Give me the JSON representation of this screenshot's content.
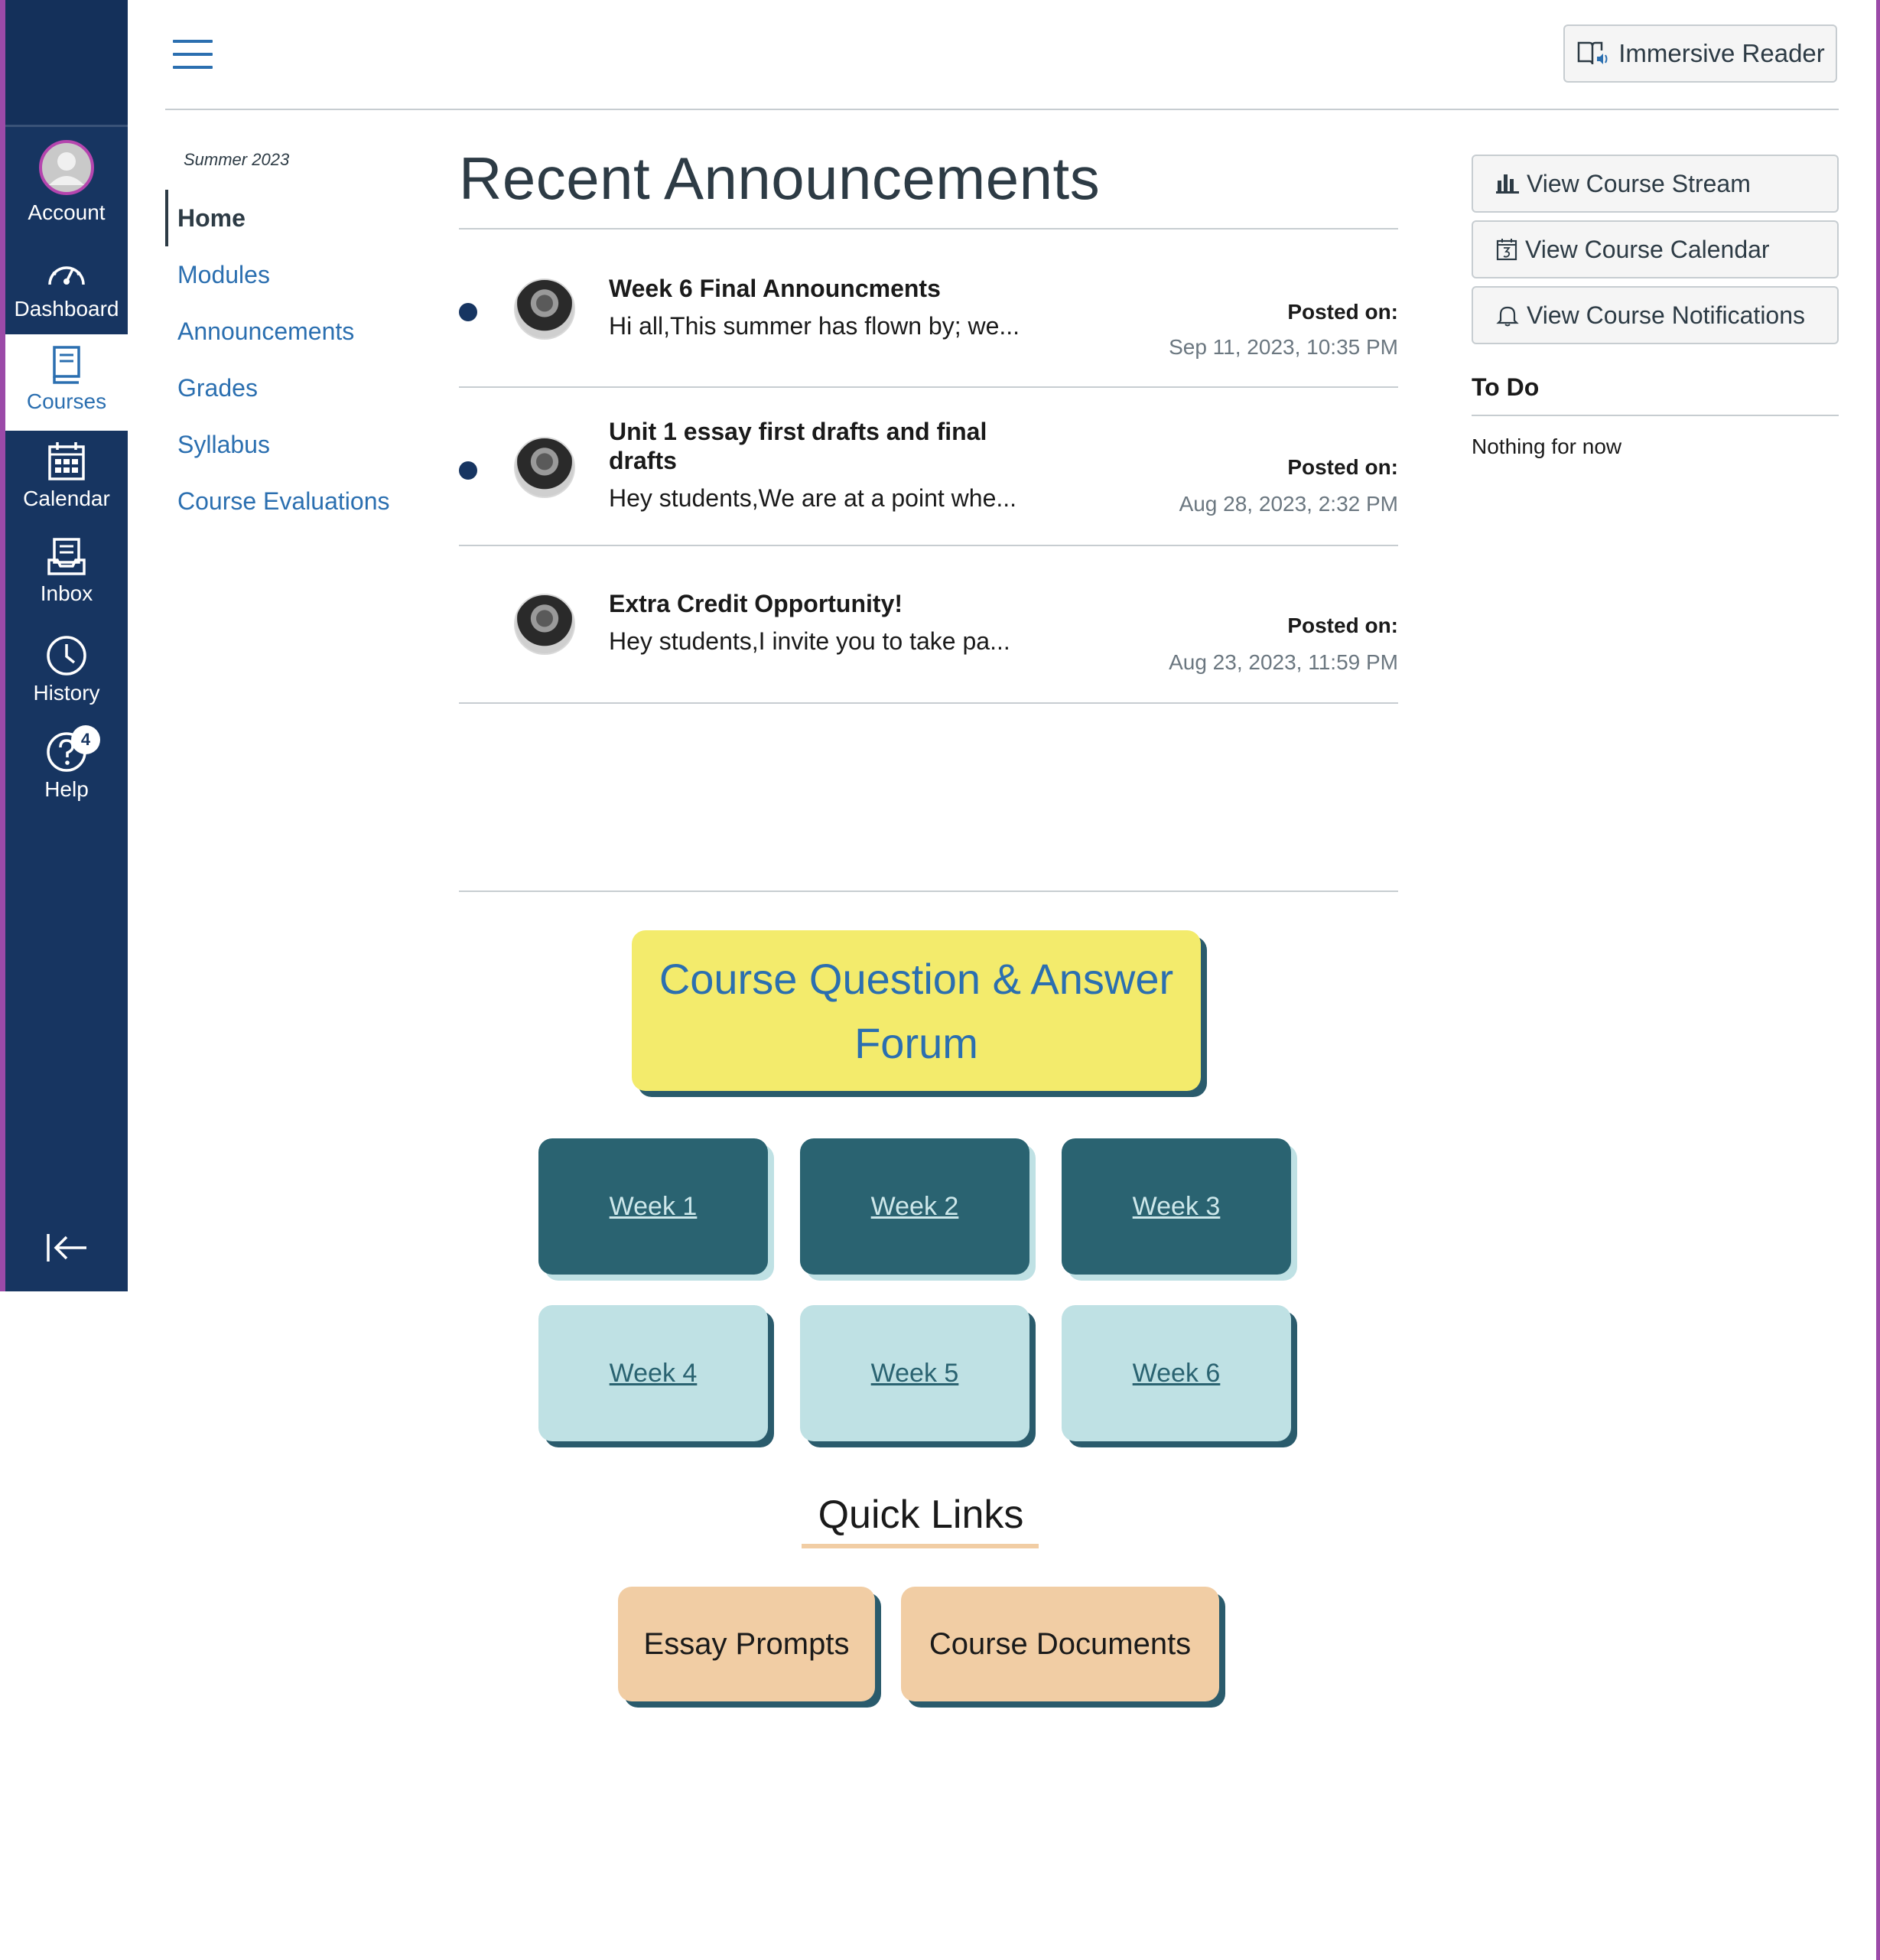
{
  "global_nav": {
    "account": "Account",
    "dashboard": "Dashboard",
    "courses": "Courses",
    "calendar": "Calendar",
    "inbox": "Inbox",
    "history": "History",
    "help": "Help",
    "help_badge": "4"
  },
  "header": {
    "immersive_reader": "Immersive Reader"
  },
  "course_nav": {
    "term": "Summer 2023",
    "items": [
      {
        "label": "Home"
      },
      {
        "label": "Modules"
      },
      {
        "label": "Announcements"
      },
      {
        "label": "Grades"
      },
      {
        "label": "Syllabus"
      },
      {
        "label": "Course Evaluations"
      }
    ]
  },
  "announcements": {
    "title": "Recent Announcements",
    "posted_label": "Posted on:",
    "items": [
      {
        "title": "Week 6 Final Announcments",
        "snippet": "Hi all,This summer has flown by; we...",
        "date": "Sep 11, 2023, 10:35 PM",
        "unread": true
      },
      {
        "title": "Unit 1 essay first drafts and final drafts",
        "snippet": "Hey students,We are at a point whe...",
        "date": "Aug 28, 2023, 2:32 PM",
        "unread": true
      },
      {
        "title": "Extra Credit Opportunity!",
        "snippet": "Hey students,I invite you to take pa...",
        "date": "Aug 23, 2023, 11:59 PM",
        "unread": false
      }
    ]
  },
  "sidebar": {
    "view_stream": "View Course Stream",
    "view_calendar": "View Course Calendar",
    "view_notifications": "View Course Notifications",
    "todo_title": "To Do",
    "todo_empty": "Nothing for now"
  },
  "content": {
    "qa_forum": "Course Question & Answer Forum",
    "weeks": [
      "Week 1",
      "Week 2",
      "Week 3",
      "Week 4",
      "Week 5",
      "Week 6"
    ],
    "quick_links_title": "Quick Links",
    "quick_links": [
      "Essay Prompts",
      "Course Documents"
    ]
  },
  "colors": {
    "nav_bg": "#173561",
    "link": "#2b6fb0",
    "frame": "#9b4aa8",
    "qa_bg": "#f3eb6c",
    "week_dark": "#2a6371",
    "week_light": "#bfe1e4",
    "quick_link_bg": "#f1cda4"
  }
}
